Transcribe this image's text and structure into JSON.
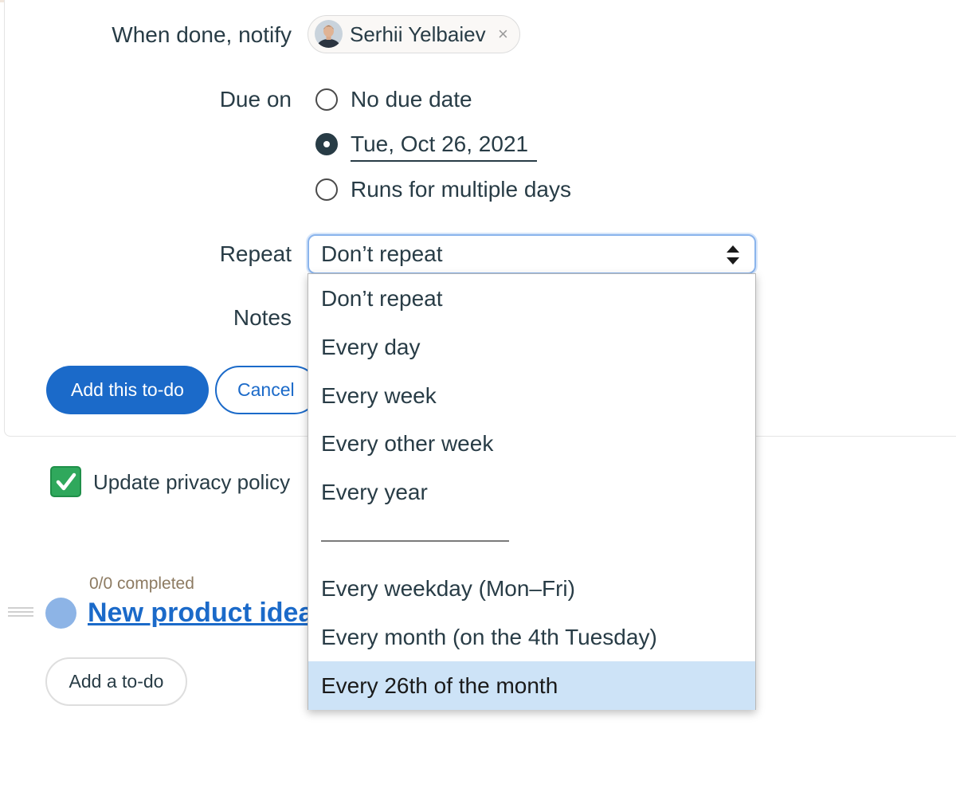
{
  "form": {
    "notify_label": "When done, notify",
    "notify_person": "Serhii Yelbaiev",
    "notify_remove": "×",
    "due_label": "Due on",
    "due_options": [
      {
        "label": "No due date",
        "checked": false
      },
      {
        "label": "Tue, Oct 26, 2021",
        "checked": true
      },
      {
        "label": "Runs for multiple days",
        "checked": false
      }
    ],
    "repeat_label": "Repeat",
    "repeat_value": "Don’t repeat",
    "notes_label": "Notes",
    "submit_label": "Add this to-do",
    "cancel_label": "Cancel"
  },
  "repeat_dropdown": {
    "options": [
      "Don’t repeat",
      "Every day",
      "Every week",
      "Every other week",
      "Every year",
      "Every weekday (Mon–Fri)",
      "Every month (on the 4th Tuesday)",
      "Every 26th of the month"
    ],
    "highlighted": "Every 26th of the month"
  },
  "todos": {
    "completed_item": "Update privacy policy",
    "list_progress": "0/0 completed",
    "list_title": "New product ideas",
    "add_label": "Add a to-do"
  },
  "colors": {
    "primary": "#1b6ac9",
    "highlight": "#cde3f7",
    "check_green": "#2fa85c",
    "text": "#283c46"
  }
}
